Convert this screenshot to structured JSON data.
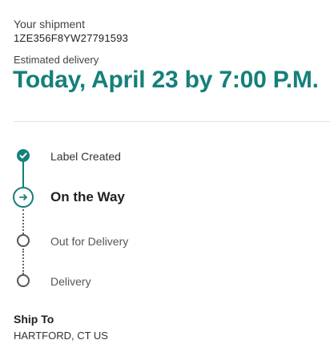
{
  "shipment": {
    "label": "Your shipment",
    "tracking_number": "1ZE356F8YW27791593"
  },
  "delivery": {
    "label": "Estimated delivery",
    "date": "Today, April 23 by 7:00 P.M."
  },
  "timeline": {
    "steps": [
      {
        "label": "Label Created",
        "status": "complete",
        "icon": "check-icon"
      },
      {
        "label": "On the Way",
        "status": "current",
        "icon": "arrow-right-icon"
      },
      {
        "label": "Out for Delivery",
        "status": "pending",
        "icon": "empty-circle-icon"
      },
      {
        "label": "Delivery",
        "status": "pending",
        "icon": "empty-circle-icon"
      }
    ]
  },
  "ship_to": {
    "label": "Ship To",
    "value": "HARTFORD, CT US"
  },
  "colors": {
    "accent": "#15807a",
    "pending": "#555555",
    "divider": "#e2e2e2"
  }
}
